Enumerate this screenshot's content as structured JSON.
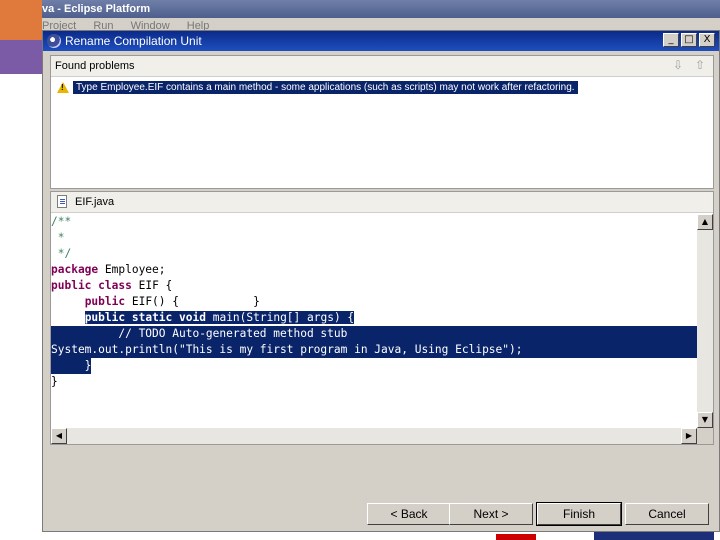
{
  "background_window": {
    "title": "va - Eclipse Platform",
    "menu": [
      "Project",
      "Run",
      "Window",
      "Help"
    ]
  },
  "dialog": {
    "title": "Rename Compilation Unit",
    "window_buttons": {
      "minimize": "_",
      "maximize": "□",
      "close": "X"
    }
  },
  "problems": {
    "header": "Found problems",
    "nav_down": "⇩",
    "nav_up": "⇧",
    "items": [
      {
        "icon": "warning-icon",
        "text": "Type Employee.EIF contains a main method - some applications (such as scripts) may not work after refactoring."
      }
    ]
  },
  "preview": {
    "tab_label": "EIF.java",
    "code": {
      "l1": "/**",
      "l2": " *",
      "l3": " */",
      "l4_kw": "package",
      "l4_rest": " Employee;",
      "l5_kw1": "public",
      "l5_kw2": "class",
      "l5_rest": " EIF {",
      "l6_indent": "     ",
      "l6_kw": "public",
      "l6_rest": " EIF() {           }",
      "l7_indent": "     ",
      "l7_kw1": "public",
      "l7_kw2": "static",
      "l7_kw3": "void",
      "l7_rest": " main(String[] args) {",
      "l8_indent": "          ",
      "l8_comment": "// TODO",
      "l8_rest": " Auto-generated method stub",
      "l9": "System.out.println(\"This is my first program in Java, Using Eclipse\");",
      "l10": "     }",
      "l11": "}"
    },
    "selected_lines": [
      7,
      8,
      9,
      10
    ]
  },
  "buttons": {
    "back": "< Back",
    "next": "Next >",
    "finish": "Finish",
    "cancel": "Cancel"
  },
  "colors": {
    "titlebar": "#0a246a",
    "selection": "#0a246a",
    "keyword": "#7f0055",
    "comment": "#3f7f5f",
    "warning": "#e8b600"
  }
}
